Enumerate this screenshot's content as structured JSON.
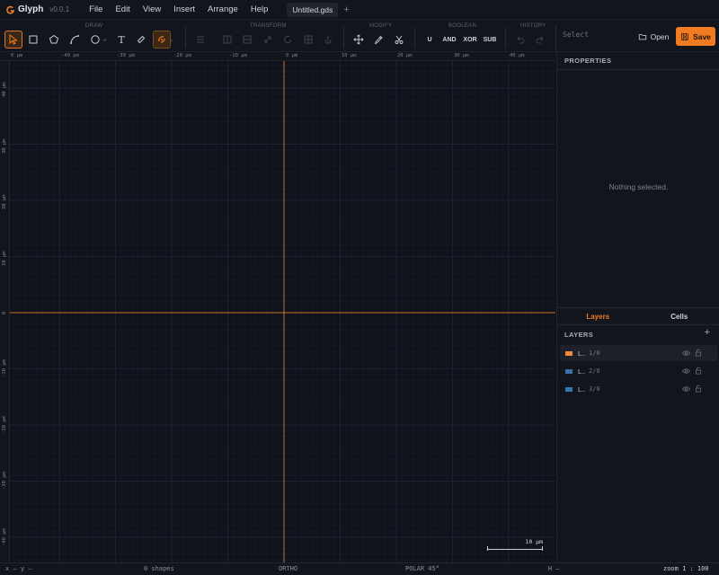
{
  "app": {
    "name": "Glyph",
    "version": "v0.0.1"
  },
  "menu": [
    "File",
    "Edit",
    "View",
    "Insert",
    "Arrange",
    "Help"
  ],
  "document_tab": {
    "title": "Untitled.gds",
    "add_label": "+"
  },
  "toolbar": {
    "groups": {
      "draw": "DRAW",
      "transform": "TRANSFORM",
      "modify": "MODIFY",
      "boolean": "BOOLEAN",
      "history": "HISTORY"
    },
    "boolean_ops": [
      "U",
      "AND",
      "XOR",
      "SUB"
    ],
    "select_label": "Select",
    "open_label": "Open",
    "save_label": "Save",
    "text_tool_glyph": "T"
  },
  "rulers": {
    "top_labels": [
      "0 µm",
      "-40 µm",
      "-30 µm",
      "-20 µm",
      "-10 µm",
      "0 µm",
      "10 µm",
      "20 µm",
      "30 µm",
      "40 µm"
    ],
    "left_labels": [
      "40 µm",
      "30 µm",
      "20 µm",
      "10 µm",
      "0",
      "-10 µm",
      "-20 µm",
      "-30 µm",
      "-40 µm"
    ]
  },
  "scale_bar": {
    "label": "10 µm"
  },
  "properties": {
    "title": "PROPERTIES",
    "empty_message": "Nothing selected."
  },
  "panel_tabs": [
    "Layers",
    "Cells"
  ],
  "layers_panel": {
    "title": "LAYERS",
    "add_label": "+",
    "layers": [
      {
        "name": "L..",
        "number": "1/0",
        "color": "#f08a3c",
        "selected": true
      },
      {
        "name": "L..",
        "number": "2/0",
        "color": "#3b6fa8",
        "selected": false
      },
      {
        "name": "L..",
        "number": "3/0",
        "color": "#2e79b0",
        "selected": false
      }
    ]
  },
  "status": {
    "coords": "x — y —",
    "shapes": "0 shapes",
    "ortho": "ORTHO",
    "polar": "POLAR 45°",
    "h": "H —",
    "zoom": "zoom 1 : 100"
  },
  "colors": {
    "accent": "#f07b22",
    "canvas": "#0f121a",
    "panel": "#12151c",
    "axis": "#c9732c"
  }
}
